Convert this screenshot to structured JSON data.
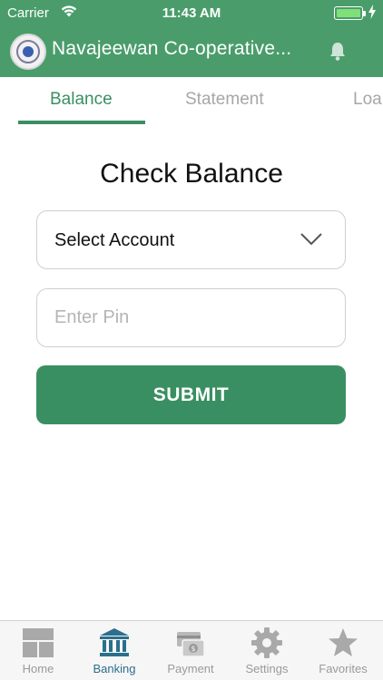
{
  "status_bar": {
    "carrier": "Carrier",
    "time": "11:43 AM"
  },
  "header": {
    "title": "Navajeewan Co-operative...",
    "logo_icon": "bank-seal-logo",
    "bell_icon": "bell-icon"
  },
  "tabs": [
    {
      "label": "Balance",
      "active": true
    },
    {
      "label": "Statement",
      "active": false
    },
    {
      "label": "Loa",
      "active": false
    }
  ],
  "main": {
    "heading": "Check Balance",
    "select_account": {
      "value": "Select Account",
      "icon": "chevron-down-icon"
    },
    "pin": {
      "placeholder": "Enter Pin",
      "value": ""
    },
    "submit_label": "SUBMIT"
  },
  "bottom_nav": [
    {
      "label": "Home",
      "icon": "home-icon",
      "active": false
    },
    {
      "label": "Banking",
      "icon": "bank-icon",
      "active": true
    },
    {
      "label": "Payment",
      "icon": "payment-icon",
      "active": false
    },
    {
      "label": "Settings",
      "icon": "gear-icon",
      "active": false
    },
    {
      "label": "Favorites",
      "icon": "star-icon",
      "active": false
    }
  ],
  "colors": {
    "brand_green": "#4a9d6b",
    "accent_green": "#3a8f62",
    "nav_active": "#2b6f8c",
    "inactive_gray": "#a7a7a7"
  }
}
